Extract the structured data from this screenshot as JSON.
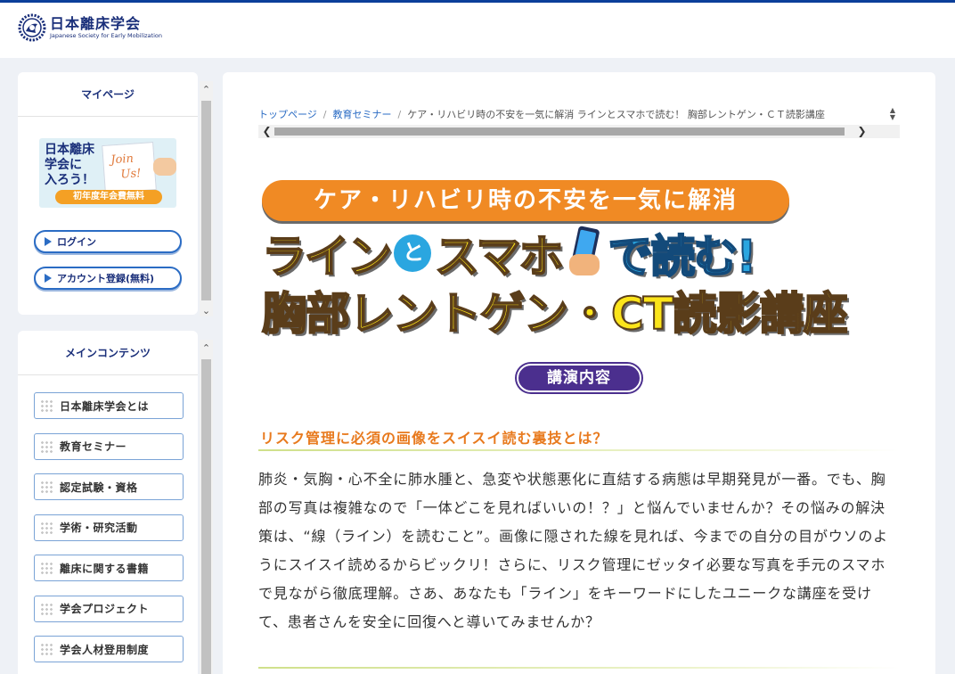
{
  "header": {
    "logo_jp": "日本離床学会",
    "logo_en": "Japanese Society for Early Mobilization"
  },
  "sidebar": {
    "mypage": {
      "title": "マイページ",
      "banner": {
        "text_line1": "日本離床",
        "text_line2": "学会に",
        "text_line3": "入ろう！",
        "board_line1": "Join",
        "board_line2": "Us!",
        "bar": "初年度年会費無料"
      },
      "login": "ログイン",
      "register": "アカウント登録(無料)"
    },
    "main_contents": {
      "title": "メインコンテンツ",
      "items": [
        {
          "label": "日本離床学会とは"
        },
        {
          "label": "教育セミナー"
        },
        {
          "label": "認定試験・資格"
        },
        {
          "label": "学術・研究活動"
        },
        {
          "label": "離床に関する書籍"
        },
        {
          "label": "学会プロジェクト"
        },
        {
          "label": "学会人材登用制度"
        }
      ]
    }
  },
  "breadcrumb": {
    "home": "トップページ",
    "category": "教育セミナー",
    "current": "ケア・リハビリ時の不安を一気に解消 ラインとスマホで読む！ 胸部レントゲン・ＣＴ読影講座"
  },
  "hero": {
    "tagline": "ケア・リハビリ時の不安を一気に解消",
    "line2_a": "ライン",
    "line2_to": "と",
    "line2_b": "スマホ",
    "line2_c": "で読む!",
    "line3": "胸部レントゲン・CT読影講座"
  },
  "section_badge": "講演内容",
  "article": {
    "heading": "リスク管理に必須の画像をスイスイ読む裏技とは？",
    "body": "肺炎・気胸・心不全に肺水腫と、急変や状態悪化に直結する病態は早期発見が一番。でも、胸部の写真は複雑なので「一体どこを見ればいいの！？」と悩んでいませんか？その悩みの解決策は、“線（ライン）を読むこと”。画像に隠された線を見れば、今までの自分の目がウソのようにスイスイ読めるからビックリ！さらに、リスク管理にゼッタイ必要な写真を手元のスマホで見ながら徹底理解。さあ、あなたも「ライン」をキーワードにしたユニークな講座を受けて、患者さんを安全に回復へと導いてみませんか？"
  },
  "colors": {
    "brand": "#1a2f7a",
    "accent_orange": "#f08a24",
    "badge_purple": "#4b2f8e",
    "link_blue": "#2b6cc4"
  }
}
